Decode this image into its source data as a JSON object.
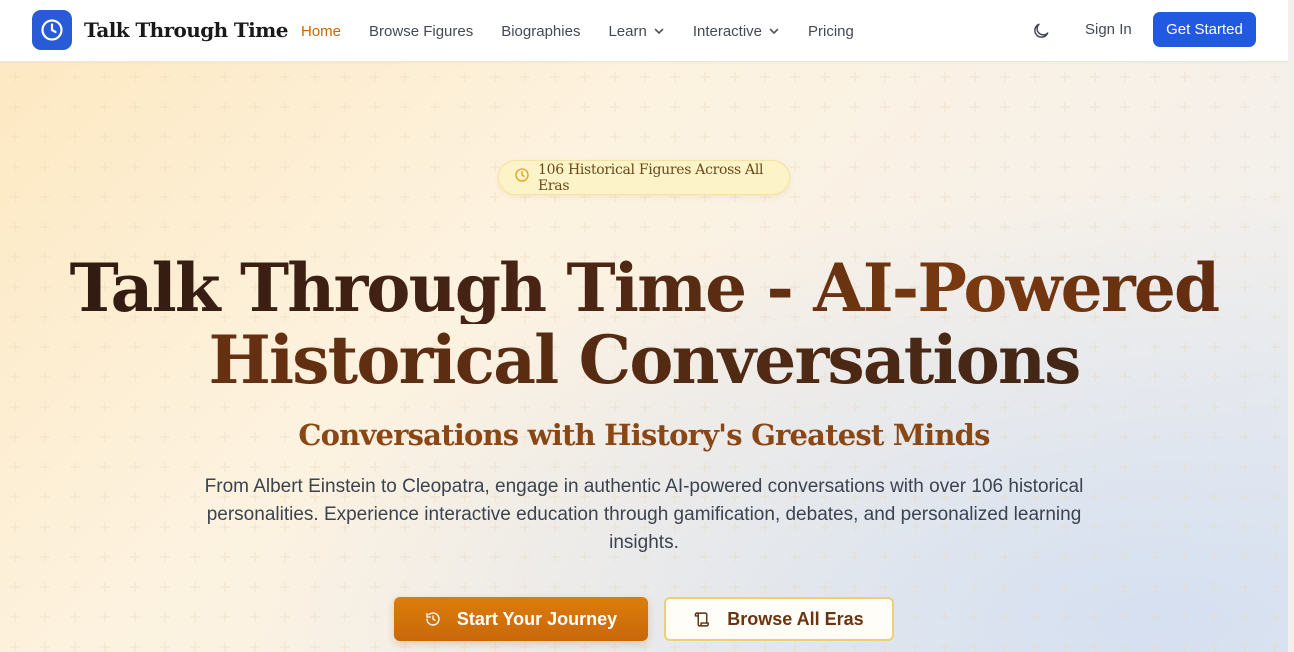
{
  "brand": {
    "name": "Talk Through Time",
    "icon": "clock-icon",
    "accent": "#2a5bd7"
  },
  "nav": {
    "links": [
      {
        "label": "Home",
        "active": true
      },
      {
        "label": "Browse Figures"
      },
      {
        "label": "Biographies"
      },
      {
        "label": "Learn",
        "has_dropdown": true
      },
      {
        "label": "Interactive",
        "has_dropdown": true
      },
      {
        "label": "Pricing"
      }
    ],
    "theme_toggle_icon": "moon-icon",
    "sign_in": "Sign In",
    "get_started": "Get Started"
  },
  "hero": {
    "badge": "106 Historical Figures Across All Eras",
    "badge_icon": "clock-icon",
    "headline_line1": "Talk Through Time - AI-Powered",
    "headline_line2": "Historical Conversations",
    "subtitle": "Conversations with History's Greatest Minds",
    "description": "From Albert Einstein to Cleopatra, engage in authentic AI-powered conversations with over 106 historical personalities. Experience interactive education through gamification, debates, and personalized learning insights.",
    "primary_cta": {
      "label": "Start Your Journey",
      "icon": "history-icon"
    },
    "secondary_cta": {
      "label": "Browse All Eras",
      "icon": "scroll-icon"
    }
  },
  "colors": {
    "primary_blue": "#2159e0",
    "active_nav": "#c8660a",
    "cta_orange": "#d4730a",
    "cta_border": "#efcf75"
  }
}
